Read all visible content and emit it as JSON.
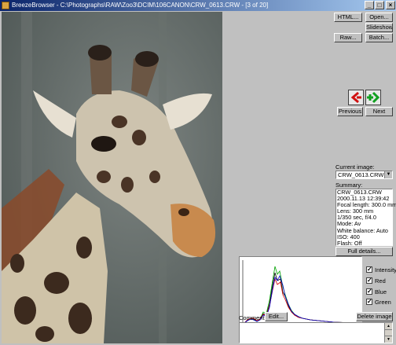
{
  "window": {
    "title": "BreezeBrowser - C:\\Photographs\\RAW\\Zoo3\\DCIM\\106CANON\\CRW_0613.CRW - [3 of 20]"
  },
  "toolbar": {
    "html": "HTML...",
    "open": "Open...",
    "slideshow": "Slideshow...",
    "raw": "Raw...",
    "batch": "Batch..."
  },
  "nav": {
    "previous": "Previous",
    "next": "Next",
    "previous_icon": "red-back-arrow-icon",
    "next_icon": "green-plus-forward-icon"
  },
  "current_image": {
    "label": "Current image:",
    "value": "CRW_0613.CRW"
  },
  "summary": {
    "label": "Summary:",
    "lines": [
      "CRW_0613.CRW",
      "2000.11.13 12:39:42",
      "Focal length: 300.0 mm",
      "Lens: 300 mm",
      "1/350 sec, f/4.0",
      "Mode: Av",
      "White balance: Auto",
      "ISO: 400",
      "Flash: Off"
    ],
    "full_details": "Full details..."
  },
  "histogram": {
    "checks": [
      {
        "label": "Intensity",
        "checked": true
      },
      {
        "label": "Red",
        "checked": true
      },
      {
        "label": "Blue",
        "checked": true
      },
      {
        "label": "Green",
        "checked": true
      }
    ]
  },
  "comments": {
    "label": "Comments:",
    "edit": "Edit...",
    "delete": "Delete image"
  },
  "colors": {
    "title_start": "#0a246a",
    "title_end": "#a6caf0",
    "face": "#c0c0c0",
    "photo_bg": "#5e6866"
  }
}
